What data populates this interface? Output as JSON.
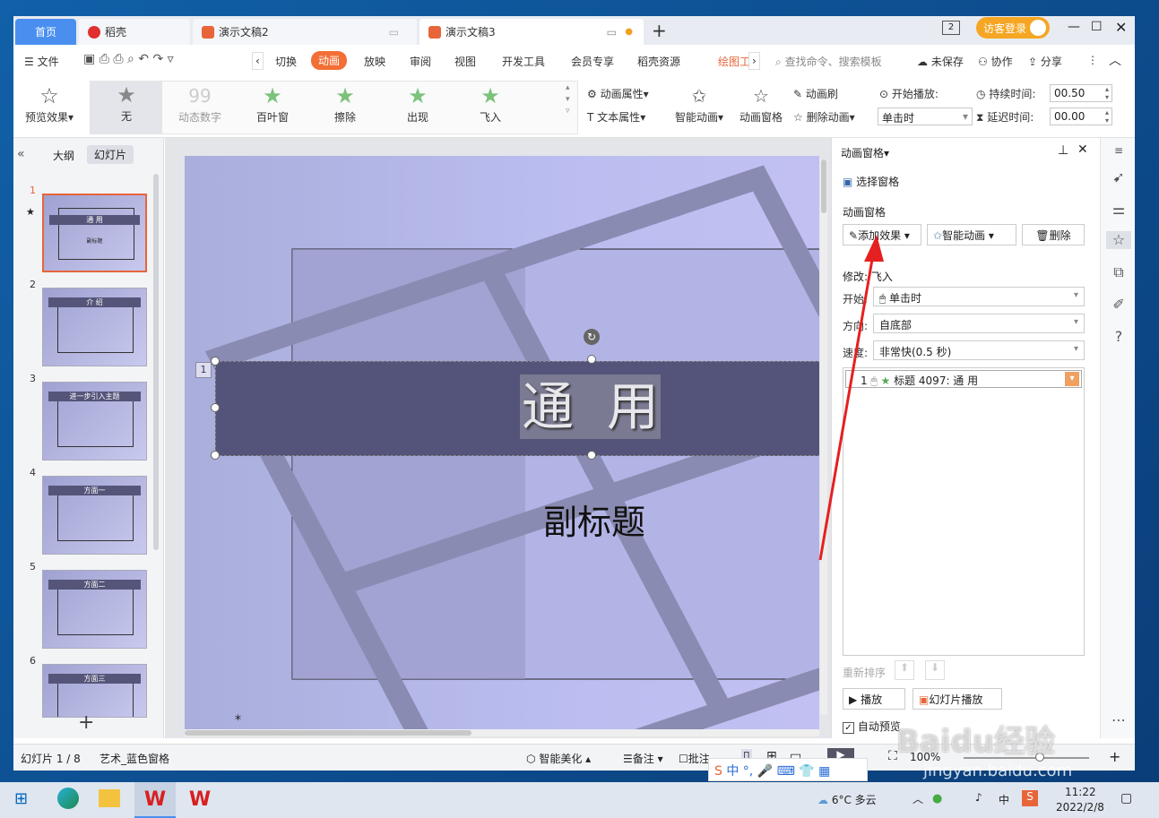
{
  "tabs": [
    {
      "label": "首页"
    },
    {
      "label": "稻壳"
    },
    {
      "label": "演示文稿2"
    },
    {
      "label": "演示文稿3"
    }
  ],
  "window": {
    "badge": "2",
    "login": "访客登录"
  },
  "menu": {
    "file": "文件",
    "items": [
      "切换",
      "动画",
      "放映",
      "审阅",
      "视图",
      "开发工具",
      "会员专享",
      "稻壳资源",
      "绘图工"
    ],
    "search": "查找命令、搜索模板",
    "unsaved": "未保存",
    "collab": "协作",
    "share": "分享"
  },
  "ribbon": {
    "preview": "预览效果",
    "effects": [
      {
        "label": "无",
        "icon": "★"
      },
      {
        "label": "动态数字",
        "icon": "99"
      },
      {
        "label": "百叶窗",
        "icon": "★"
      },
      {
        "label": "擦除",
        "icon": "★"
      },
      {
        "label": "出现",
        "icon": "★"
      },
      {
        "label": "飞入",
        "icon": "★"
      }
    ],
    "anim_attr": "动画属性",
    "text_attr": "文本属性",
    "smart_anim": "智能动画",
    "anim_pane": "动画窗格",
    "anim_brush": "动画刷",
    "del_anim": "删除动画",
    "start_play": "开始播放:",
    "start_val": "单击时",
    "duration_label": "持续时间:",
    "duration_val": "00.50",
    "delay_label": "延迟时间:",
    "delay_val": "00.00"
  },
  "left": {
    "outline": "大纲",
    "slides": "幻灯片",
    "thumbs": [
      {
        "num": "1",
        "title": "通 用",
        "sub": "副标题"
      },
      {
        "num": "2",
        "title": "介 绍"
      },
      {
        "num": "3",
        "title": "进一步引入主题"
      },
      {
        "num": "4",
        "title": "方面一"
      },
      {
        "num": "5",
        "title": "方面二"
      },
      {
        "num": "6",
        "title": "方面三"
      }
    ],
    "add": "+"
  },
  "slide": {
    "title": "通  用",
    "subtitle": "副标题",
    "anim_num": "1",
    "placeholder": "*"
  },
  "pane": {
    "header": "动画窗格",
    "select_pane": "选择窗格",
    "section": "动画窗格",
    "add_effect": "添加效果",
    "smart": "智能动画",
    "delete": "删除",
    "modify": "修改: 飞入",
    "start_label": "开始:",
    "start_val": "单击时",
    "dir_label": "方向:",
    "dir_val": "自底部",
    "speed_label": "速度:",
    "speed_val": "非常快(0.5 秒)",
    "list": [
      {
        "num": "1",
        "text": "标题 4097: 通  用"
      }
    ],
    "reorder": "重新排序",
    "play": "播放",
    "slideshow": "幻灯片播放",
    "autopreview": "自动预览"
  },
  "status": {
    "slide": "幻灯片 1 / 8",
    "theme": "艺术_蓝色窗格",
    "beautify": "智能美化",
    "notes": "备注",
    "comment": "批注",
    "zoom": "100%"
  },
  "taskbar": {
    "weather": "6°C 多云",
    "time": "11:22",
    "date": "2022/2/8",
    "ime": "中",
    "watermark": "Baidu经验",
    "watermark_url": "jingyan.baidu.com"
  }
}
